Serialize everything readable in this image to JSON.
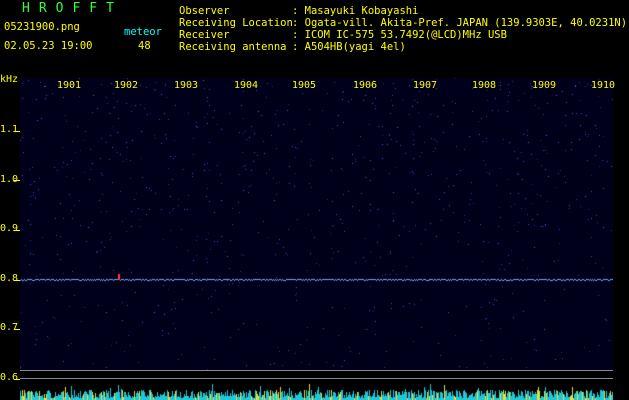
{
  "program": "HROFFT",
  "file": "05231900.png",
  "datetime": "02.05.23 19:00",
  "meteor_label": "meteor",
  "meteor_count": "48",
  "info": {
    "observer_label": "Observer",
    "observer": ": Masayuki Kobayashi",
    "location_label": "Receiving Location",
    "location": ": Ogata-vill. Akita-Pref. JAPAN (139.9303E, 40.0231N)",
    "receiver_label": "Receiver",
    "receiver": ": ICOM IC-575 53.7492(@LCD)MHz USB",
    "antenna_label": "Receiving antenna",
    "antenna": ": A504HB(yagi 4el)"
  },
  "axis": {
    "unit": "kHz",
    "y_ticks": [
      "1.1",
      "1.0",
      "0.9",
      "0.8",
      "0.7",
      "0.6"
    ],
    "x_ticks": [
      "1901",
      "1902",
      "1903",
      "1904",
      "1905",
      "1906",
      "1907",
      "1908",
      "1909",
      "1910"
    ]
  },
  "colors": {
    "text": "#ffff00",
    "info": "#00ffff",
    "title": "#33ff33",
    "signal": "#6fa8ff"
  }
}
